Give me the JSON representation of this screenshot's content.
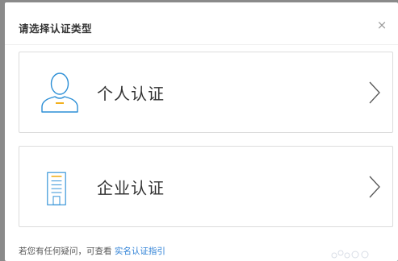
{
  "dialog": {
    "title": "请选择认证类型",
    "close_glyph": "×"
  },
  "options": [
    {
      "label": "个人认证",
      "icon": "user-profile-icon"
    },
    {
      "label": "企业认证",
      "icon": "building-icon"
    }
  ],
  "footer": {
    "text": "若您有任何疑问，可查看",
    "link_text": "实名认证指引"
  },
  "colors": {
    "icon_blue": "#2c8fd6",
    "icon_accent": "#f2b01e",
    "link": "#2b7fd6"
  }
}
